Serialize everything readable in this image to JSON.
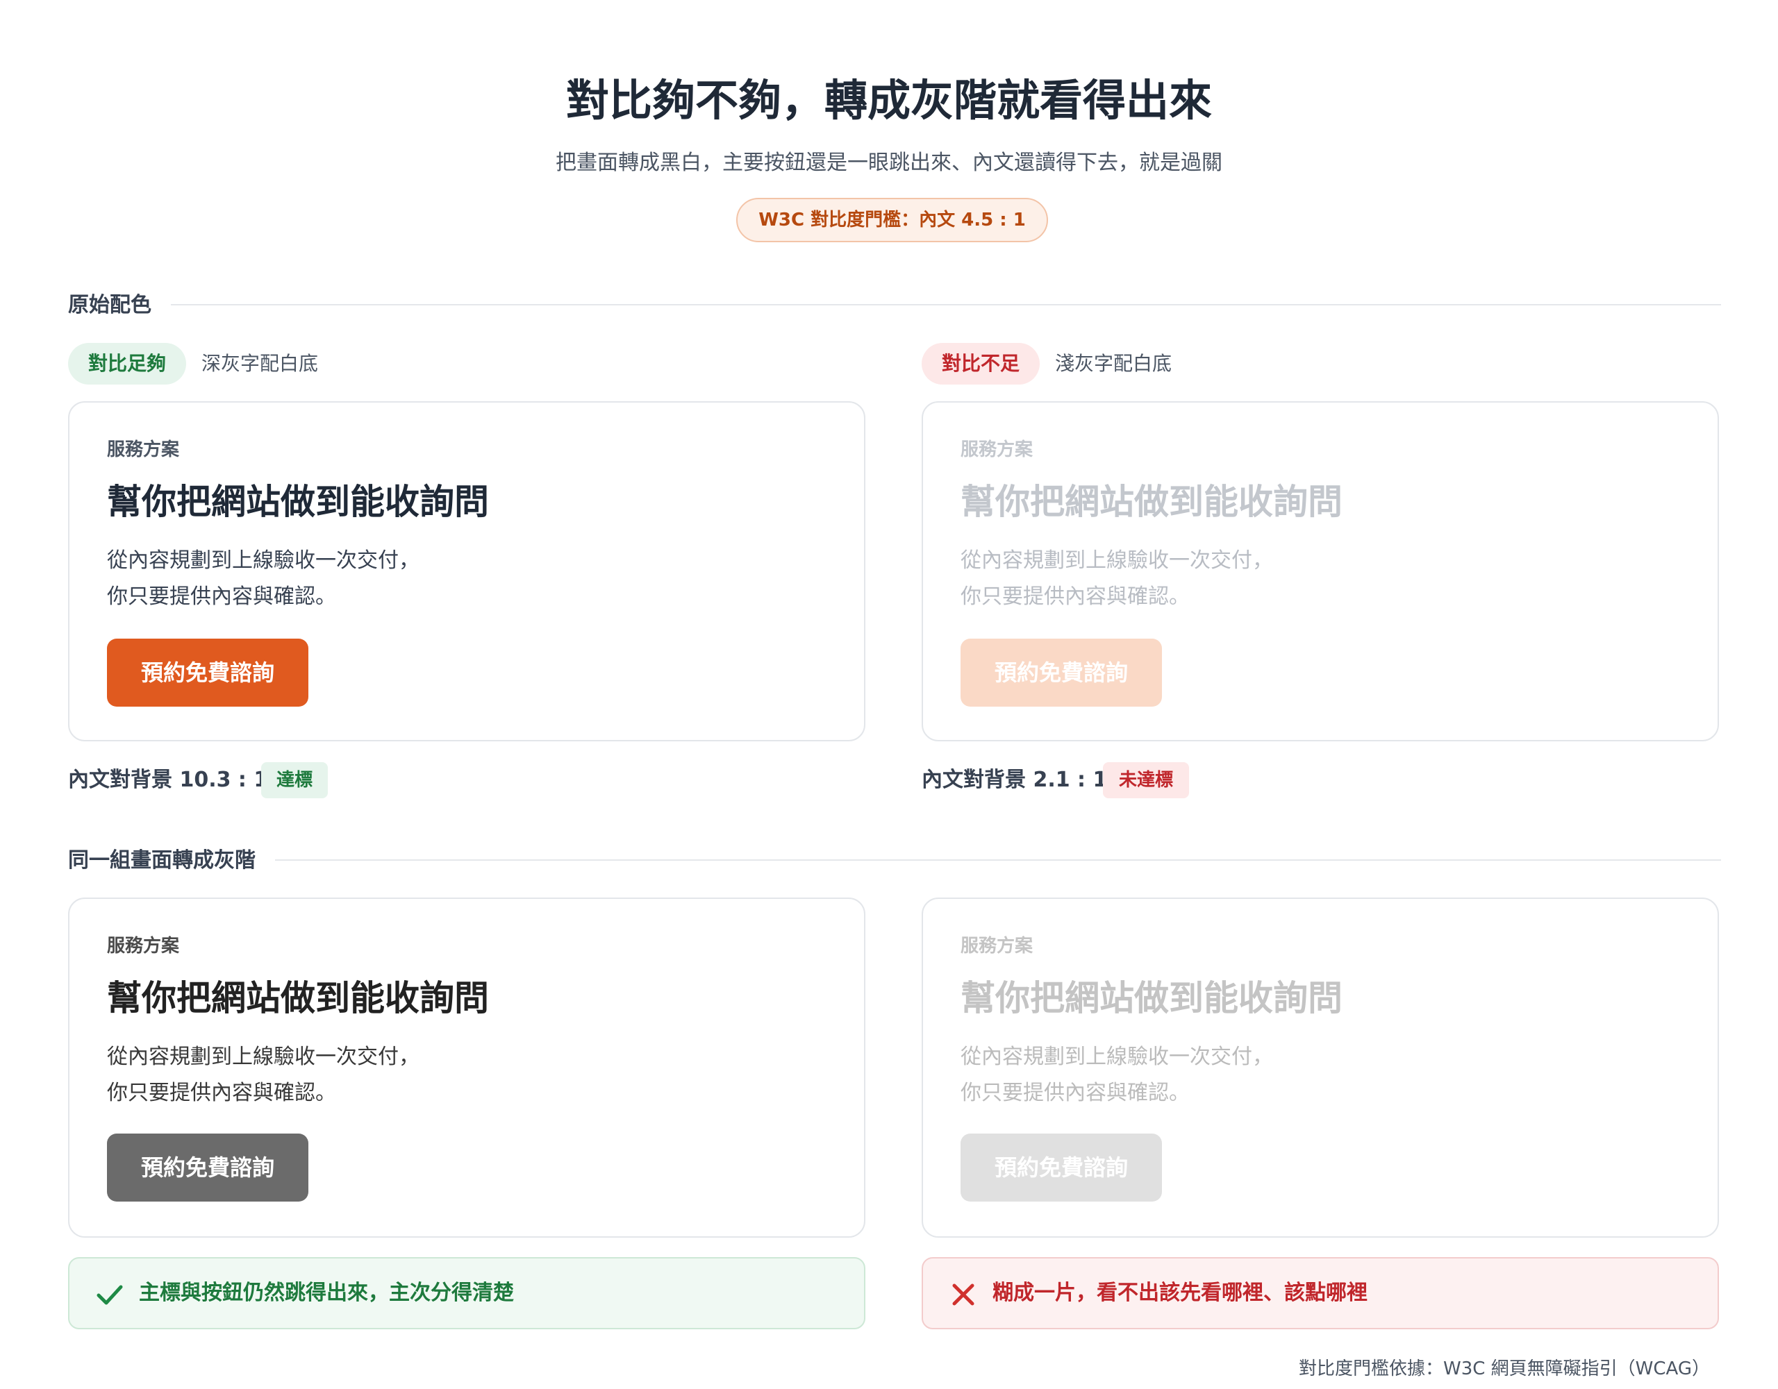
{
  "header": {
    "title": "對比夠不夠，轉成灰階就看得出來",
    "subtitle": "把畫面轉成黑白，主要按鈕還是一眼跳出來、內文還讀得下去，就是過關",
    "threshold_pill": "W3C 對比度門檻：內文 4.5 : 1"
  },
  "sections": {
    "original_label": "原始配色",
    "grayscale_label": "同一組畫面轉成灰階"
  },
  "variants": {
    "good": {
      "tag": "對比足夠",
      "caption": "深灰字配白底",
      "ratio_text": "內文對背景 10.3 : 1",
      "ratio_badge": "達標"
    },
    "bad": {
      "tag": "對比不足",
      "caption": "淺灰字配白底",
      "ratio_text": "內文對背景 2.1 : 1",
      "ratio_badge": "未達標"
    }
  },
  "card": {
    "kicker": "服務方案",
    "heading": "幫你把網站做到能收詢問",
    "body_line1": "從內容規劃到上線驗收一次交付，",
    "body_line2": "你只要提供內容與確認。",
    "button": "預約免費諮詢"
  },
  "verdicts": {
    "good": "主標與按鈕仍然跳得出來，主次分得清楚",
    "bad": "糊成一片，看不出該先看哪裡、該點哪裡"
  },
  "footnote": "對比度門檻依據：W3C 網頁無障礙指引（WCAG）",
  "colors": {
    "good_text": "#1f2937",
    "good_body": "#374151",
    "good_button": "#e05a1f",
    "bad_text": "#c3c7cd",
    "bad_button": "#fad9c6",
    "gray_button": "#6b6b6b",
    "gray_bad_button": "#e0e0e0"
  }
}
